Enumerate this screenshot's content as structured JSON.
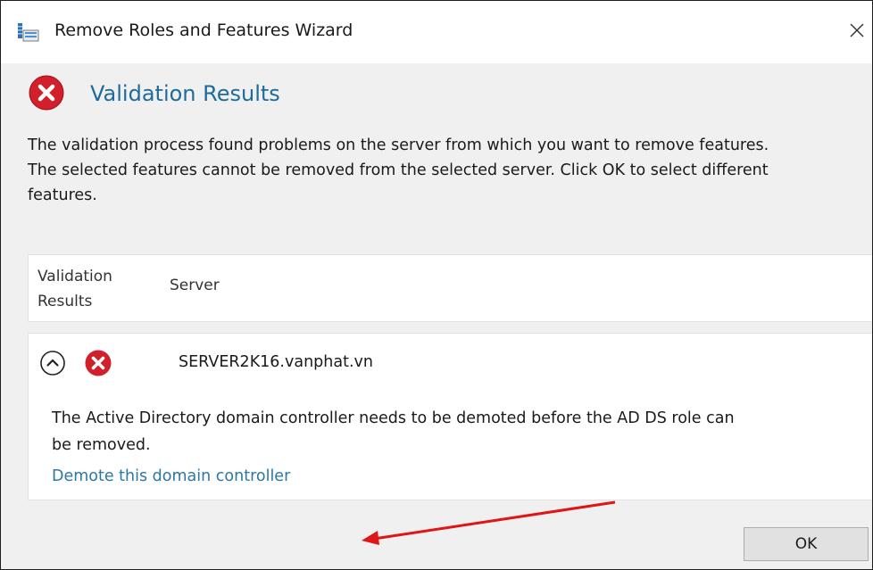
{
  "window": {
    "title": "Remove Roles and Features Wizard",
    "icon": "server-manager-icon",
    "close_icon": "close-icon"
  },
  "header": {
    "icon": "error-icon",
    "title": "Validation Results",
    "title_color": "#1e6b9c"
  },
  "message": "The validation process found problems on the server from which you want to remove features.\nThe selected features cannot be removed from the selected server.  Click OK to select different\nfeatures.",
  "grid": {
    "columns": [
      "Validation\nResults",
      "Server"
    ]
  },
  "result": {
    "expand_icon": "chevron-up-icon",
    "status_icon": "error-icon",
    "server": "SERVER2K16.vanphat.vn",
    "detail": "The Active Directory domain controller needs to be demoted before the AD DS role can\nbe removed.",
    "link": "Demote this domain controller",
    "link_color": "#2b77a6"
  },
  "annotation": {
    "type": "red-arrow",
    "color": "#e01515"
  },
  "footer": {
    "ok_label": "OK"
  }
}
